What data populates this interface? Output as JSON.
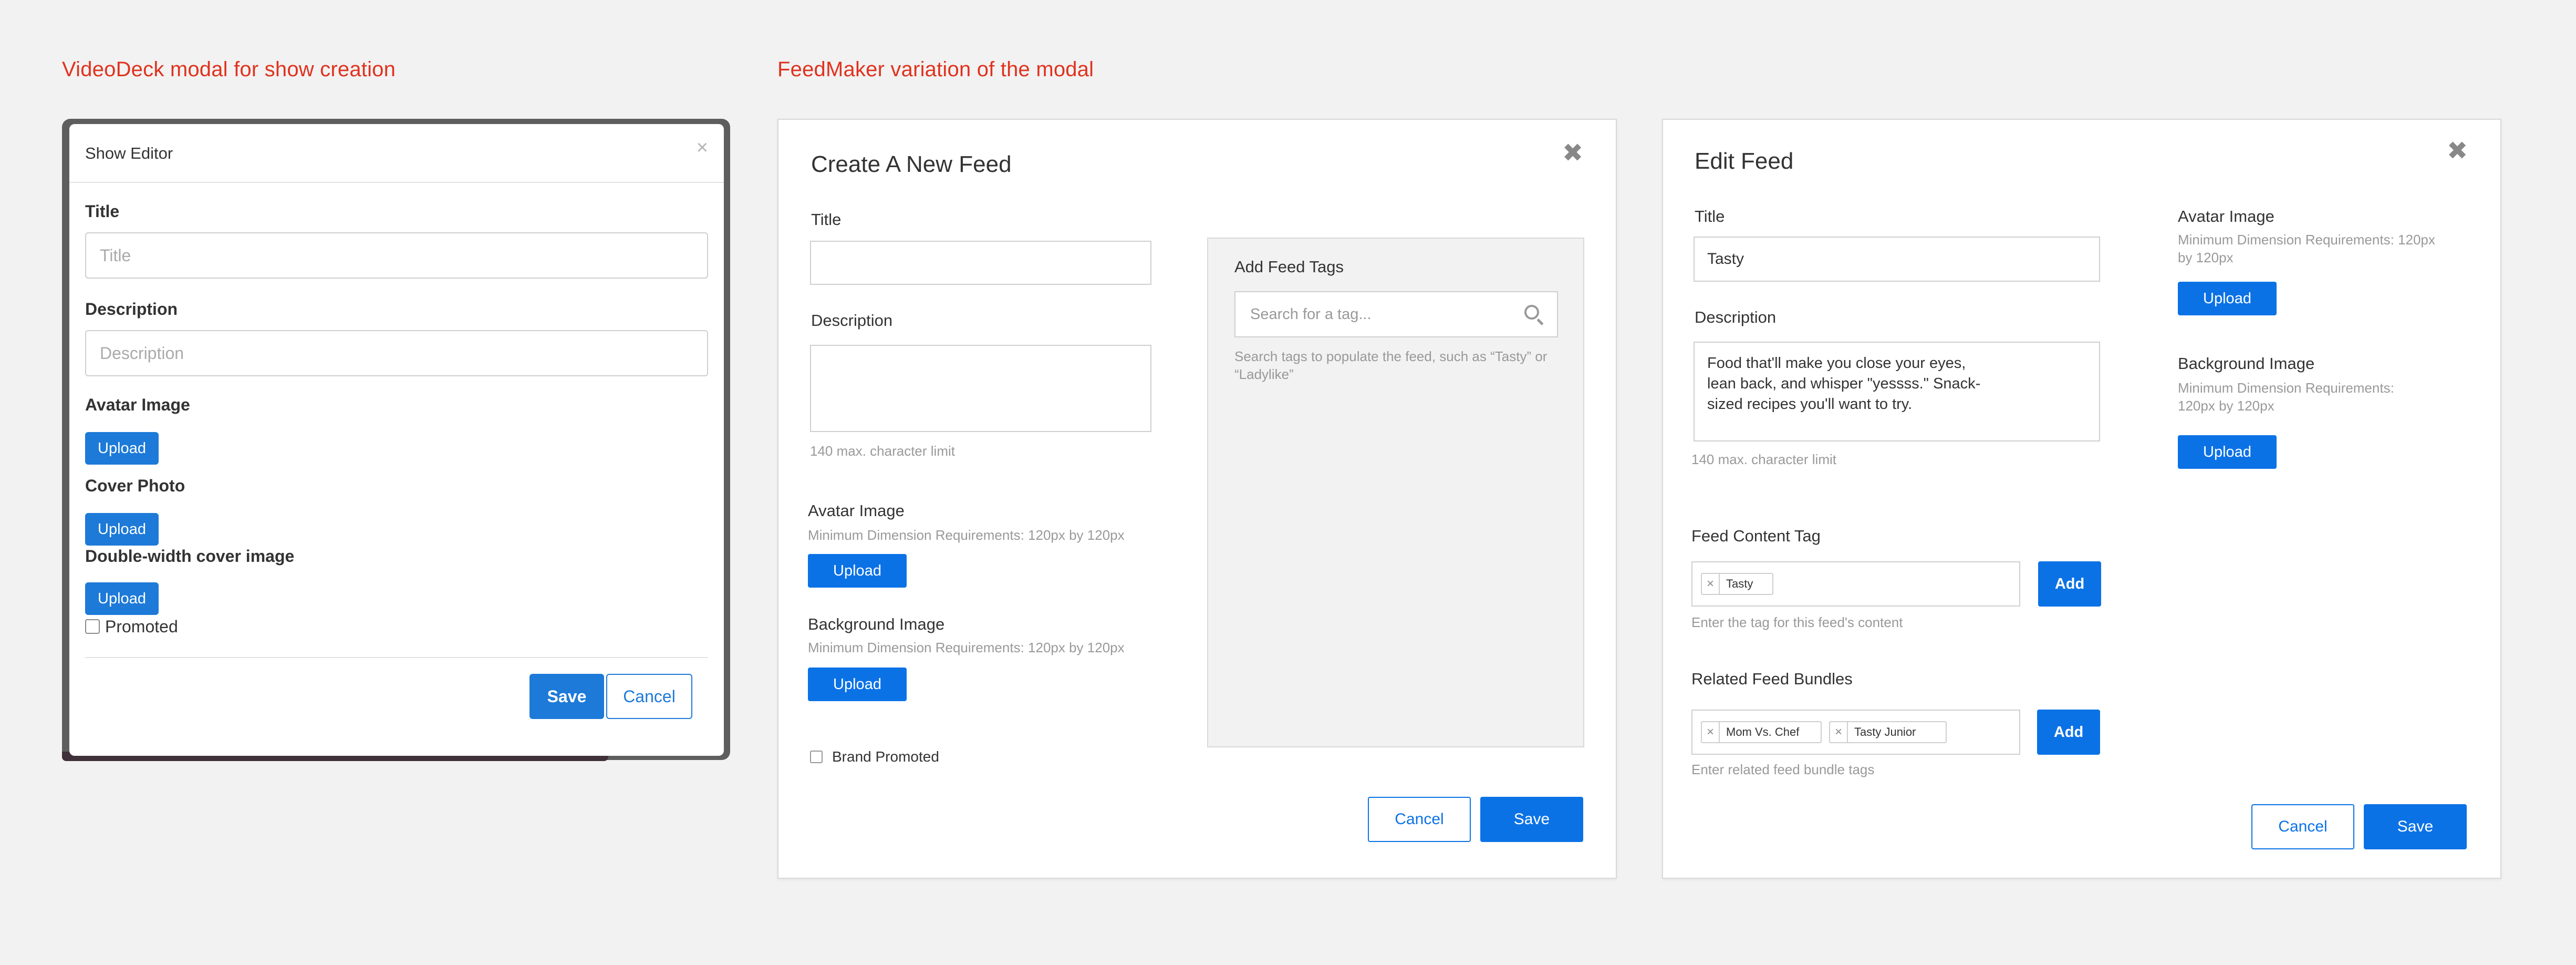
{
  "headings": {
    "videodeck": "VideoDeck modal for show creation",
    "feedmaker": "FeedMaker variation of the modal"
  },
  "videodeck": {
    "title": "Show Editor",
    "close": "×",
    "title_label": "Title",
    "title_placeholder": "Title",
    "description_label": "Description",
    "description_placeholder": "Description",
    "avatar_label": "Avatar Image",
    "cover_label": "Cover Photo",
    "double_label": "Double-width cover image",
    "upload": "Upload",
    "promoted_label": "Promoted",
    "save": "Save",
    "cancel": "Cancel"
  },
  "create_feed": {
    "title": "Create A New Feed",
    "close": "✖",
    "title_label": "Title",
    "description_label": "Description",
    "char_limit": "140 max. character limit",
    "avatar_label": "Avatar Image",
    "avatar_hint": "Minimum Dimension Requirements: 120px by 120px",
    "background_label": "Background Image",
    "background_hint": "Minimum Dimension Requirements: 120px by 120px",
    "upload": "Upload",
    "brand_promoted": "Brand Promoted",
    "tags_heading": "Add Feed Tags",
    "search_placeholder": "Search for a tag...",
    "search_hint": "Search tags to populate the feed, such as “Tasty” or “Ladylike”",
    "cancel": "Cancel",
    "save": "Save"
  },
  "edit_feed": {
    "title": "Edit Feed",
    "close": "✖",
    "title_label": "Title",
    "title_value": "Tasty",
    "description_label": "Description",
    "description_lines": [
      "Food that'll make you close your eyes,",
      "lean back, and whisper \"yessss.\" Snack-",
      "sized recipes you'll want to try."
    ],
    "char_limit": "140 max. character limit",
    "content_tag_label": "Feed Content Tag",
    "content_tags": [
      "Tasty"
    ],
    "content_tag_hint": "Enter the tag for this feed's content",
    "related_label": "Related Feed Bundles",
    "related_tags": [
      "Mom Vs. Chef",
      "Tasty Junior"
    ],
    "related_hint": "Enter related feed bundle tags",
    "add": "Add",
    "avatar_label": "Avatar Image",
    "avatar_hint_lines": [
      "Minimum Dimension Requirements: 120px",
      "by 120px"
    ],
    "background_label": "Background Image",
    "background_hint_lines": [
      "Minimum Dimension Requirements:",
      "120px by 120px"
    ],
    "upload": "Upload",
    "cancel": "Cancel",
    "save": "Save"
  },
  "colors": {
    "heading_red": "#e0321e",
    "primary_blue": "#0b72e6",
    "videodeck_blue": "#1d7ad8"
  }
}
